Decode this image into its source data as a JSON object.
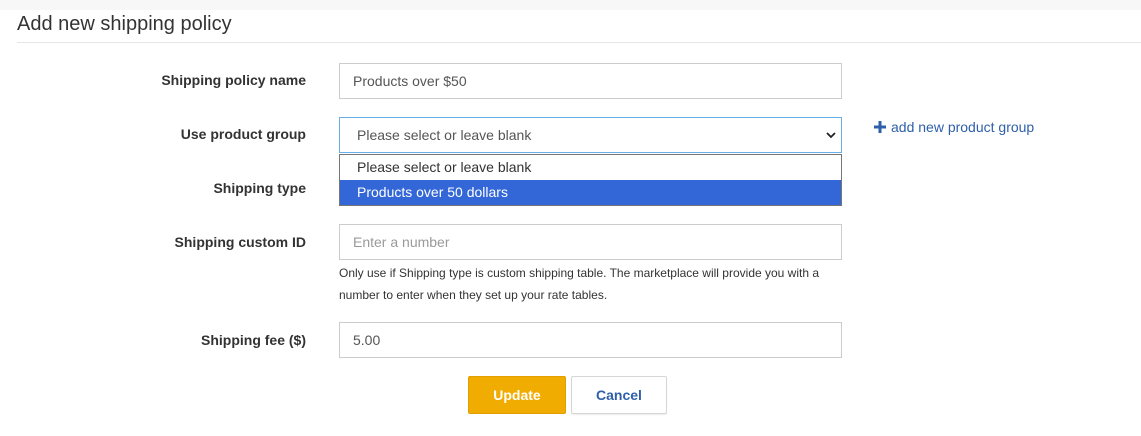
{
  "page": {
    "title": "Add new shipping policy"
  },
  "form": {
    "policy_name": {
      "label": "Shipping policy name",
      "value": "Products over $50"
    },
    "product_group": {
      "label": "Use product group",
      "selected": "Please select or leave blank",
      "options": [
        "Please select or leave blank",
        "Products over 50 dollars"
      ],
      "highlighted_option": "Products over 50 dollars",
      "add_link": "add new product group"
    },
    "shipping_type": {
      "label": "Shipping type"
    },
    "custom_id": {
      "label": "Shipping custom ID",
      "placeholder": "Enter a number",
      "help": "Only use if Shipping type is custom shipping table. The marketplace will provide you with a number to enter when they set up your rate tables."
    },
    "shipping_fee": {
      "label": "Shipping fee ($)",
      "value": "5.00"
    }
  },
  "buttons": {
    "update": "Update",
    "cancel": "Cancel"
  },
  "icons": {
    "plus": "plus-icon",
    "chevron": "chevron-down-icon"
  },
  "colors": {
    "accent_button": "#f0ac00",
    "link": "#2e5fa8",
    "selection": "#3366d6",
    "focus_border": "#66afe9"
  }
}
